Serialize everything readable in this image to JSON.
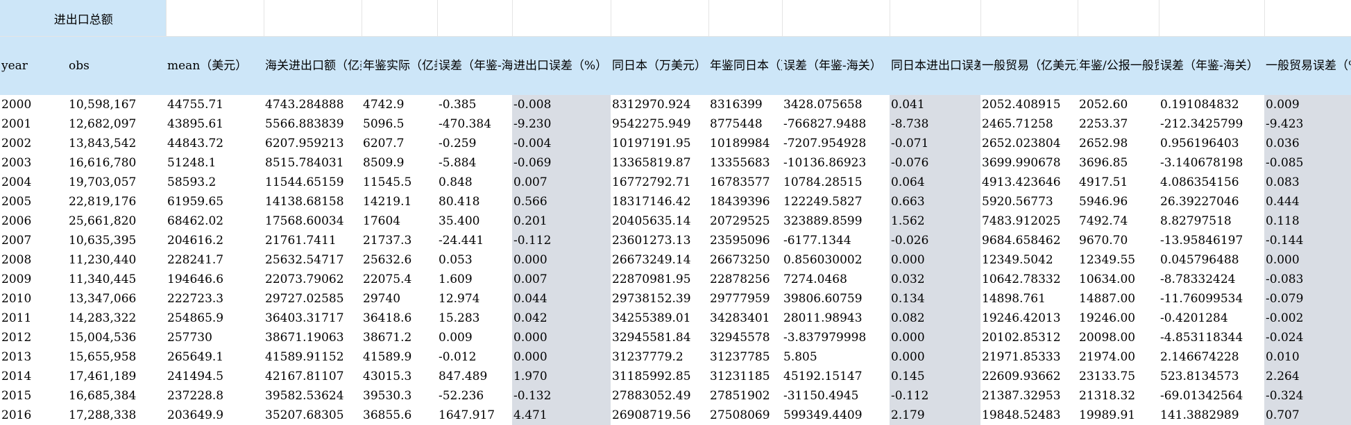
{
  "sheet": {
    "title": "进出口总额",
    "headers": [
      "year",
      "obs",
      "mean（美元）",
      "海关进出口额（亿美元）",
      "年鉴实际（亿美元）",
      "误差（年鉴-海关）",
      "进出口误差（%）",
      "同日本（万美元）",
      "年鉴同日本（万美元）",
      "误差（年鉴-海关）",
      "同日本进出口误差（%）",
      "一般贸易（亿美元）",
      "年鉴/公报一般贸易（亿美元）",
      "误差（年鉴-海关）",
      "一般贸易误差（%）"
    ],
    "rows": [
      [
        "2000",
        "10,598,167",
        "44755.71",
        "4743.284888",
        "4742.9",
        "-0.385",
        "-0.008",
        "8312970.924",
        "8316399",
        "3428.075658",
        "0.041",
        "2052.408915",
        "2052.60",
        "0.191084832",
        "0.009"
      ],
      [
        "2001",
        "12,682,097",
        "43895.61",
        "5566.883839",
        "5096.5",
        "-470.384",
        "-9.230",
        "9542275.949",
        "8775448",
        "-766827.9488",
        "-8.738",
        "2465.71258",
        "2253.37",
        "-212.3425799",
        "-9.423"
      ],
      [
        "2002",
        "13,843,542",
        "44843.72",
        "6207.959213",
        "6207.7",
        "-0.259",
        "-0.004",
        "10197191.95",
        "10189984",
        "-7207.954928",
        "-0.071",
        "2652.023804",
        "2652.98",
        "0.956196403",
        "0.036"
      ],
      [
        "2003",
        "16,616,780",
        "51248.1",
        "8515.784031",
        "8509.9",
        "-5.884",
        "-0.069",
        "13365819.87",
        "13355683",
        "-10136.86923",
        "-0.076",
        "3699.990678",
        "3696.85",
        "-3.140678198",
        "-0.085"
      ],
      [
        "2004",
        "19,703,057",
        "58593.2",
        "11544.65159",
        "11545.5",
        "0.848",
        "0.007",
        "16772792.71",
        "16783577",
        "10784.28515",
        "0.064",
        "4913.423646",
        "4917.51",
        "4.086354156",
        "0.083"
      ],
      [
        "2005",
        "22,819,176",
        "61959.65",
        "14138.68158",
        "14219.1",
        "80.418",
        "0.566",
        "18317146.42",
        "18439396",
        "122249.5827",
        "0.663",
        "5920.56773",
        "5946.96",
        "26.39227046",
        "0.444"
      ],
      [
        "2006",
        "25,661,820",
        "68462.02",
        "17568.60034",
        "17604",
        "35.400",
        "0.201",
        "20405635.14",
        "20729525",
        "323889.8599",
        "1.562",
        "7483.912025",
        "7492.74",
        "8.82797518",
        "0.118"
      ],
      [
        "2007",
        "10,635,395",
        "204616.2",
        "21761.7411",
        "21737.3",
        "-24.441",
        "-0.112",
        "23601273.13",
        "23595096",
        "-6177.1344",
        "-0.026",
        "9684.658462",
        "9670.70",
        "-13.95846197",
        "-0.144"
      ],
      [
        "2008",
        "11,230,440",
        "228241.7",
        "25632.54717",
        "25632.6",
        "0.053",
        "0.000",
        "26673249.14",
        "26673250",
        "0.856030002",
        "0.000",
        "12349.5042",
        "12349.55",
        "0.045796488",
        "0.000"
      ],
      [
        "2009",
        "11,340,445",
        "194646.6",
        "22073.79062",
        "22075.4",
        "1.609",
        "0.007",
        "22870981.95",
        "22878256",
        "7274.0468",
        "0.032",
        "10642.78332",
        "10634.00",
        "-8.78332424",
        "-0.083"
      ],
      [
        "2010",
        "13,347,066",
        "222723.3",
        "29727.02585",
        "29740",
        "12.974",
        "0.044",
        "29738152.39",
        "29777959",
        "39806.60759",
        "0.134",
        "14898.761",
        "14887.00",
        "-11.76099534",
        "-0.079"
      ],
      [
        "2011",
        "14,283,322",
        "254865.9",
        "36403.31717",
        "36418.6",
        "15.283",
        "0.042",
        "34255389.01",
        "34283401",
        "28011.98943",
        "0.082",
        "19246.42013",
        "19246.00",
        "-0.4201284",
        "-0.002"
      ],
      [
        "2012",
        "15,004,536",
        "257730",
        "38671.19063",
        "38671.2",
        "0.009",
        "0.000",
        "32945581.84",
        "32945578",
        "-3.837979998",
        "0.000",
        "20102.85312",
        "20098.00",
        "-4.853118344",
        "-0.024"
      ],
      [
        "2013",
        "15,655,958",
        "265649.1",
        "41589.91152",
        "41589.9",
        "-0.012",
        "0.000",
        "31237779.2",
        "31237785",
        "5.805",
        "0.000",
        "21971.85333",
        "21974.00",
        "2.146674228",
        "0.010"
      ],
      [
        "2014",
        "17,461,189",
        "241494.5",
        "42167.81107",
        "43015.3",
        "847.489",
        "1.970",
        "31185992.85",
        "31231185",
        "45192.15147",
        "0.145",
        "22609.93662",
        "23133.75",
        "523.8134573",
        "2.264"
      ],
      [
        "2015",
        "16,685,384",
        "237228.8",
        "39582.53624",
        "39530.3",
        "-52.236",
        "-0.132",
        "27883052.49",
        "27851902",
        "-31150.4945",
        "-0.112",
        "21387.32953",
        "21318.32",
        "-69.01342564",
        "-0.324"
      ],
      [
        "2016",
        "17,288,338",
        "203649.9",
        "35207.68305",
        "36855.6",
        "1647.917",
        "4.471",
        "26908719.56",
        "27508069",
        "599349.4409",
        "2.179",
        "19848.52483",
        "19989.91",
        "141.3882989",
        "0.707"
      ]
    ]
  }
}
